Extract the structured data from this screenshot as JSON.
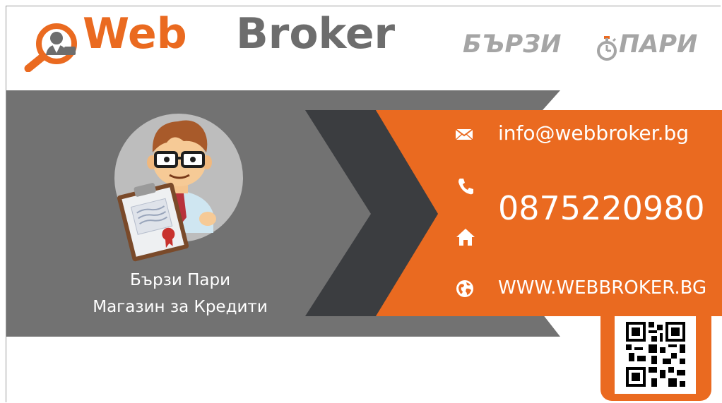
{
  "brand": {
    "web": "Web",
    "broker": "Broker",
    "slogan_left": "БЪРЗИ",
    "slogan_right": "ПАРИ",
    "logo_icon": "magnifier-person-icon",
    "stopwatch_icon": "stopwatch-icon"
  },
  "caption": {
    "line1": "Бързи Пари",
    "line2": "Магазин за Кредити"
  },
  "contact": {
    "email": "info@webbroker.bg",
    "phone": "0875220980",
    "website": "WWW.WEBBROKER.BG",
    "email_icon": "envelope-icon",
    "phone_icon": "phone-icon",
    "home_icon": "home-icon",
    "website_icon": "globe-icon"
  },
  "qr": {
    "icon": "qr-code-icon"
  },
  "colors": {
    "orange": "#ea6a20",
    "brand_gray": "#6d6d6d",
    "band_gray": "#727272",
    "chevron_dark": "#3b3d40",
    "slogan_gray": "#a5a5a5",
    "mascot_circle": "#bdbdbd",
    "caption_text": "#ffffff",
    "white": "#ffffff"
  }
}
